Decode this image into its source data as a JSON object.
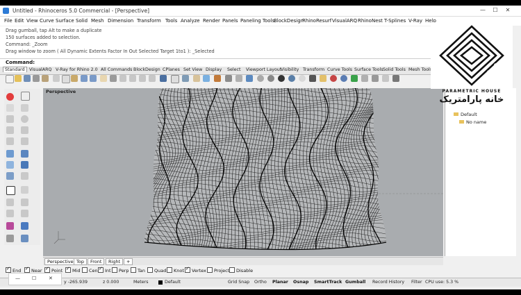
{
  "window": {
    "title": "Untitled - Rhinoceros 5.0 Commercial - [Perspective]",
    "controls": [
      "—",
      "☐",
      "✕"
    ]
  },
  "menu": [
    "File",
    "Edit",
    "View",
    "Curve",
    "Surface",
    "Solid",
    "Mesh",
    "Dimension",
    "Transform",
    "Tools",
    "Analyze",
    "Render",
    "Panels",
    "Paneling Tools",
    "BlockDesign",
    "RhinoResurf",
    "VisualARQ",
    "RhinoNest",
    "T-Splines",
    "V-Ray",
    "Help"
  ],
  "command_history": [
    "Drag gumball, tap Alt to make a duplicate",
    "150 surfaces added to selection.",
    "Command: _Zoom",
    "Drag window to zoom ( All  Dynamic  Extents  Factor  In  Out  Selected  Target  1to1 ): _Selected"
  ],
  "command_prompt": "Command:",
  "toolbar_tabs": [
    "Standard",
    "VisualARQ",
    "V-Ray for Rhino 2.0",
    "All Commands",
    "BlockDesign",
    "CPlanes",
    "Set View",
    "Display",
    "Select",
    "Viewport Layout",
    "Visibility",
    "Transform",
    "Curve Tools",
    "Surface Tools",
    "Solid Tools",
    "Mesh Tools",
    "Render Tools"
  ],
  "viewport": {
    "label": "Perspective",
    "tabs": [
      "Perspective",
      "Top",
      "Front",
      "Right"
    ],
    "add_tab": "+"
  },
  "osnaps": [
    {
      "label": "End",
      "checked": true
    },
    {
      "label": "Near",
      "checked": true
    },
    {
      "label": "Point",
      "checked": true
    },
    {
      "label": "Mid",
      "checked": true
    },
    {
      "label": "Cen",
      "checked": false
    },
    {
      "label": "Int",
      "checked": true
    },
    {
      "label": "Perp",
      "checked": false
    },
    {
      "label": "Tan",
      "checked": false
    },
    {
      "label": "Quad",
      "checked": false
    },
    {
      "label": "Knot",
      "checked": false
    },
    {
      "label": "Vertex",
      "checked": true
    },
    {
      "label": "Project",
      "checked": false
    },
    {
      "label": "Disable",
      "checked": false
    }
  ],
  "status": {
    "y": "y -265.939",
    "z": "z 0.000",
    "units": "Meters",
    "layer": "Default",
    "toggles": [
      "Grid Snap",
      "Ortho",
      "Planar",
      "Osnap",
      "SmartTrack",
      "Gumball",
      "Record History",
      "Filter"
    ],
    "cpu": "CPU use: 5.3 %"
  },
  "taskbar": {
    "minimize": "—",
    "restore": "☐",
    "close": "✕"
  },
  "right_panel": {
    "tree": [
      {
        "label": "Default"
      },
      {
        "label": "No name"
      }
    ]
  },
  "watermark": {
    "caption": "PARAMETRIC HOUSE",
    "arabic": "خانه پارامتریک"
  },
  "colors": {
    "viewport_bg": "#a9acaf",
    "mesh_line": "#1a1a1a",
    "app_bg": "#f0f0f0"
  }
}
